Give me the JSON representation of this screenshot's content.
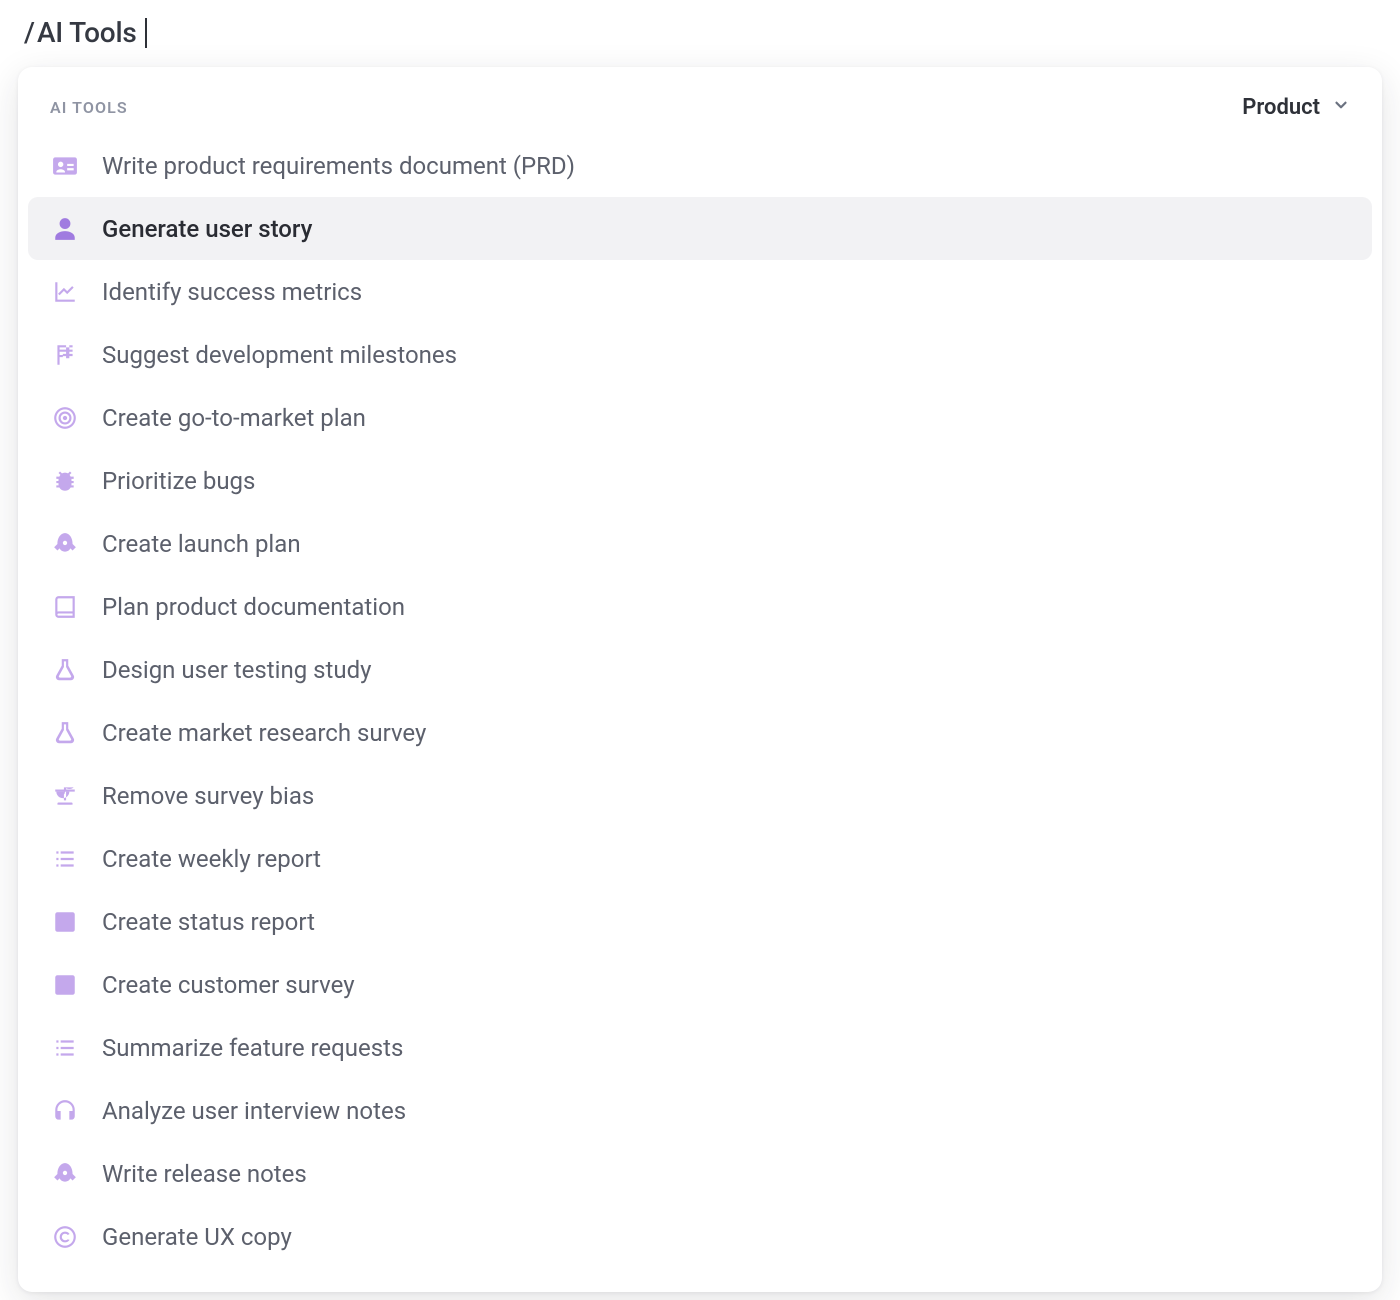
{
  "command_input": {
    "prefix": "/",
    "text": "AI Tools"
  },
  "dropdown": {
    "section_title": "AI TOOLS",
    "filter_label": "Product",
    "items": [
      {
        "label": "Write product requirements document (PRD)",
        "icon": "id-card-icon",
        "selected": false
      },
      {
        "label": "Generate user story",
        "icon": "person-icon",
        "selected": true
      },
      {
        "label": "Identify success metrics",
        "icon": "chart-line-icon",
        "selected": false
      },
      {
        "label": "Suggest development milestones",
        "icon": "flag-checkered-icon",
        "selected": false
      },
      {
        "label": "Create go-to-market plan",
        "icon": "target-icon",
        "selected": false
      },
      {
        "label": "Prioritize bugs",
        "icon": "bug-icon",
        "selected": false
      },
      {
        "label": "Create launch plan",
        "icon": "rocket-icon",
        "selected": false
      },
      {
        "label": "Plan product documentation",
        "icon": "book-icon",
        "selected": false
      },
      {
        "label": "Design user testing study",
        "icon": "flask-icon",
        "selected": false
      },
      {
        "label": "Create market research survey",
        "icon": "flask-icon",
        "selected": false
      },
      {
        "label": "Remove survey bias",
        "icon": "balance-icon",
        "selected": false
      },
      {
        "label": "Create weekly report",
        "icon": "list-icon",
        "selected": false
      },
      {
        "label": "Create status report",
        "icon": "report-icon",
        "selected": false
      },
      {
        "label": "Create customer survey",
        "icon": "bar-chart-icon",
        "selected": false
      },
      {
        "label": "Summarize feature requests",
        "icon": "list-icon",
        "selected": false
      },
      {
        "label": "Analyze user interview notes",
        "icon": "headset-icon",
        "selected": false
      },
      {
        "label": "Write release notes",
        "icon": "rocket-icon",
        "selected": false
      },
      {
        "label": "Generate UX copy",
        "icon": "copyright-icon",
        "selected": false
      }
    ]
  },
  "colors": {
    "icon_default": "#c4a8ec",
    "icon_selected": "#a07be0",
    "row_selected_bg": "#f2f2f4",
    "label_default": "#5c606c",
    "label_selected": "#2a2c33",
    "section_title": "#8f94a3"
  }
}
